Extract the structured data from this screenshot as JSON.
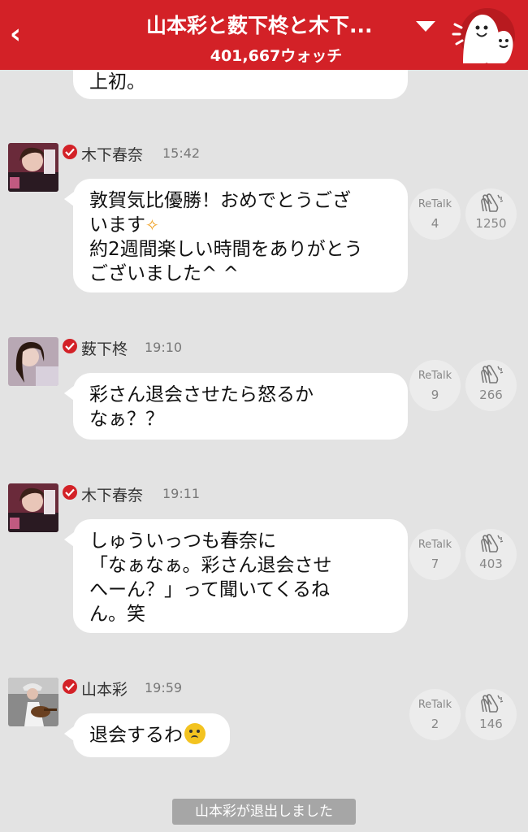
{
  "header": {
    "back_icon": "chevron-left-icon",
    "title": "山本彩と薮下柊と木下...",
    "watch_count": "401,667ウォッチ",
    "mascot_icon": "mascot-ghost-icon",
    "color": "#d32127"
  },
  "partial_bubble": {
    "text": "上初。"
  },
  "messages": [
    {
      "name": "木下春奈",
      "time": "15:42",
      "lines": [
        "敦賀気比優勝！おめでとうござ",
        "います",
        "約2週間楽しい時間をありがとう",
        "ございました^ ^"
      ],
      "sparkle": "✧",
      "retalk_label": "ReTalk",
      "retalk": "4",
      "claps": "1250"
    },
    {
      "name": "薮下柊",
      "time": "19:10",
      "lines": [
        "彩さん退会させたら怒るか",
        "なぁ？？"
      ],
      "retalk_label": "ReTalk",
      "retalk": "9",
      "claps": "266"
    },
    {
      "name": "木下春奈",
      "time": "19:11",
      "lines": [
        "しゅういっつも春奈に",
        "「なぁなぁ。彩さん退会させ",
        "へーん？」って聞いてくるね",
        "ん。笑"
      ],
      "retalk_label": "ReTalk",
      "retalk": "7",
      "claps": "403"
    },
    {
      "name": "山本彩",
      "time": "19:59",
      "lines": [
        "退会するわ"
      ],
      "emoji": "frown-emoji-icon",
      "retalk_label": "ReTalk",
      "retalk": "2",
      "claps": "146"
    }
  ],
  "notice": "山本彩が退出しました"
}
